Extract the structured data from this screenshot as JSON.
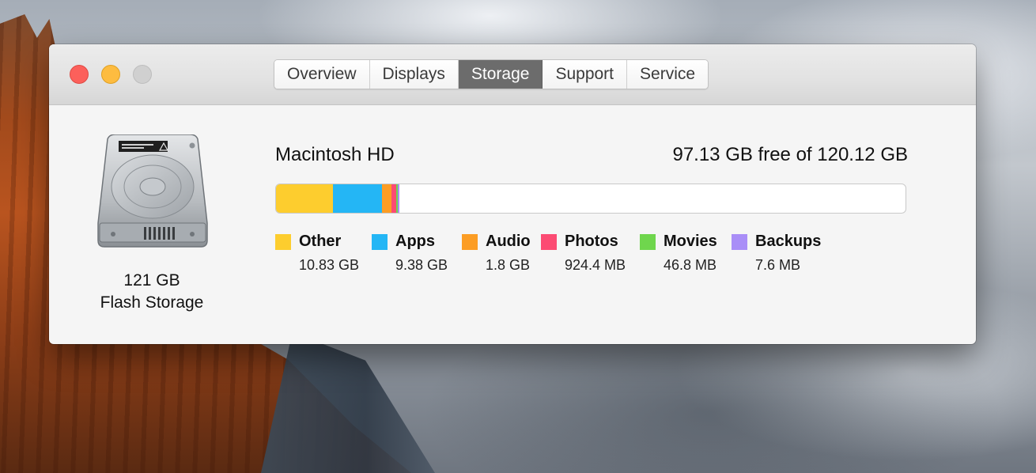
{
  "window": {
    "tabs": [
      {
        "label": "Overview"
      },
      {
        "label": "Displays"
      },
      {
        "label": "Storage",
        "active": true
      },
      {
        "label": "Support"
      },
      {
        "label": "Service"
      }
    ]
  },
  "drive": {
    "size": "121 GB",
    "type": "Flash Storage",
    "icon": "hard-drive-icon"
  },
  "volume": {
    "name": "Macintosh HD",
    "free_text": "97.13 GB free of 120.12 GB",
    "total_gb": 120.12
  },
  "categories": [
    {
      "name": "Other",
      "size": "10.83 GB",
      "gb": 10.83,
      "color": "#fdcd2e"
    },
    {
      "name": "Apps",
      "size": "9.38 GB",
      "gb": 9.38,
      "color": "#24b6f5"
    },
    {
      "name": "Audio",
      "size": "1.8 GB",
      "gb": 1.8,
      "color": "#fc9d24"
    },
    {
      "name": "Photos",
      "size": "924.4 MB",
      "gb": 0.9244,
      "color": "#fc4b73"
    },
    {
      "name": "Movies",
      "size": "46.8 MB",
      "gb": 0.0468,
      "color": "#6fd64d"
    },
    {
      "name": "Backups",
      "size": "7.6 MB",
      "gb": 0.0076,
      "color": "#a98ef7"
    }
  ]
}
